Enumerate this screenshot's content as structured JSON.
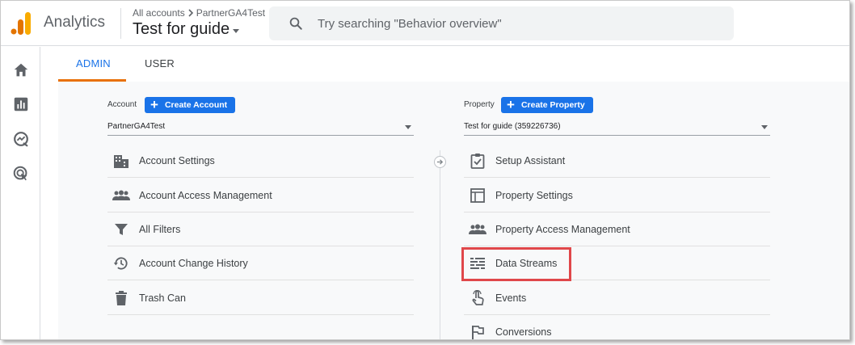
{
  "header": {
    "app_name": "Analytics",
    "breadcrumb_all_accounts": "All accounts",
    "breadcrumb_account": "PartnerGA4Test",
    "property_title": "Test for guide",
    "search_placeholder": "Try searching \"Behavior overview\""
  },
  "leftnav": {
    "icons": [
      "home-icon",
      "reports-icon",
      "explore-icon",
      "advertising-icon"
    ]
  },
  "tabs": [
    {
      "label": "ADMIN",
      "active": true
    },
    {
      "label": "USER",
      "active": false
    }
  ],
  "account_column": {
    "label": "Account",
    "create_button": "Create Account",
    "selected": "PartnerGA4Test",
    "items": [
      {
        "label": "Account Settings",
        "icon": "building-icon"
      },
      {
        "label": "Account Access Management",
        "icon": "people-icon"
      },
      {
        "label": "All Filters",
        "icon": "filter-icon"
      },
      {
        "label": "Account Change History",
        "icon": "history-icon"
      },
      {
        "label": "Trash Can",
        "icon": "trash-icon"
      }
    ]
  },
  "property_column": {
    "label": "Property",
    "create_button": "Create Property",
    "selected": "Test for guide (359226736)",
    "items": [
      {
        "label": "Setup Assistant",
        "icon": "checklist-icon"
      },
      {
        "label": "Property Settings",
        "icon": "layout-icon"
      },
      {
        "label": "Property Access Management",
        "icon": "people-icon"
      },
      {
        "label": "Data Streams",
        "icon": "data-streams-icon",
        "highlighted": true
      },
      {
        "label": "Events",
        "icon": "touch-icon"
      },
      {
        "label": "Conversions",
        "icon": "flag-icon"
      }
    ]
  },
  "colors": {
    "accent_blue": "#1a73e8",
    "tab_underline": "#e8710a",
    "highlight_box": "#e0474a",
    "logo_orange": "#f9ab00",
    "logo_dark_orange": "#e37400"
  }
}
